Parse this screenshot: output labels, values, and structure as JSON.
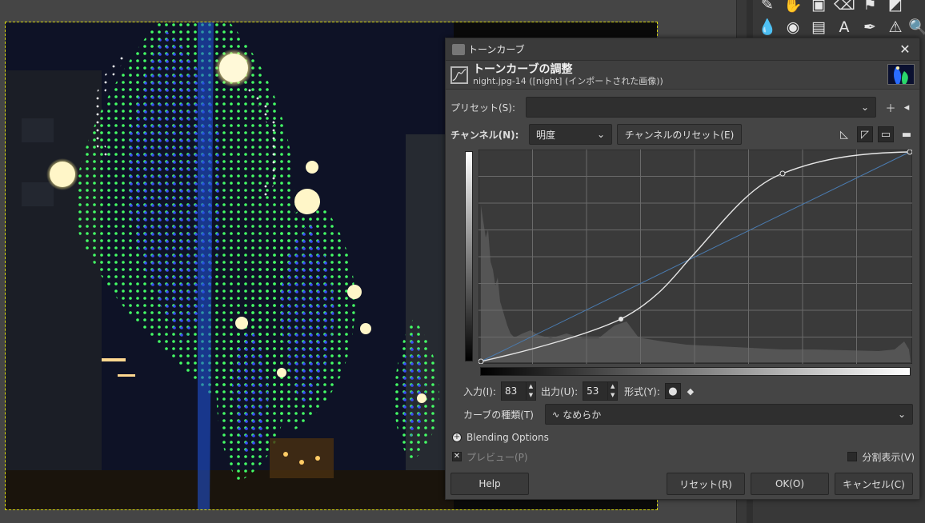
{
  "dialog": {
    "window_title": "トーンカーブ",
    "header_title": "トーンカーブの調整",
    "header_subtitle": "night.jpg-14 ([night] (インポートされた画像))",
    "preset_label": "プリセット(S):",
    "preset_value": "",
    "channel_label": "チャンネル(N):",
    "channel_value": "明度",
    "channel_reset_label": "チャンネルのリセット(E)",
    "input_label": "入力(I):",
    "input_value": "83",
    "output_label": "出力(U):",
    "output_value": "53",
    "type_label": "形式(Y):",
    "curve_type_label": "カーブの種類(T)",
    "curve_type_value": "なめらか",
    "blending_label": "Blending Options",
    "preview_label": "プレビュー(P)",
    "split_view_label": "分割表示(V)",
    "help_label": "Help",
    "reset_label": "リセット(R)",
    "ok_label": "OK(O)",
    "cancel_label": "キャンセル(C)"
  },
  "icons": {
    "close": "close-icon",
    "add_preset": "plus-icon",
    "preset_menu": "menu-icon",
    "linear_hist": "linear-histogram-icon",
    "log_hist": "log-histogram-icon",
    "smooth_point": "circle-point-icon",
    "corner_point": "diamond-point-icon"
  },
  "colors": {
    "curve": "#e6e6e6",
    "diagonal": "#4a7bb0",
    "selection_border": "#d8d810"
  }
}
